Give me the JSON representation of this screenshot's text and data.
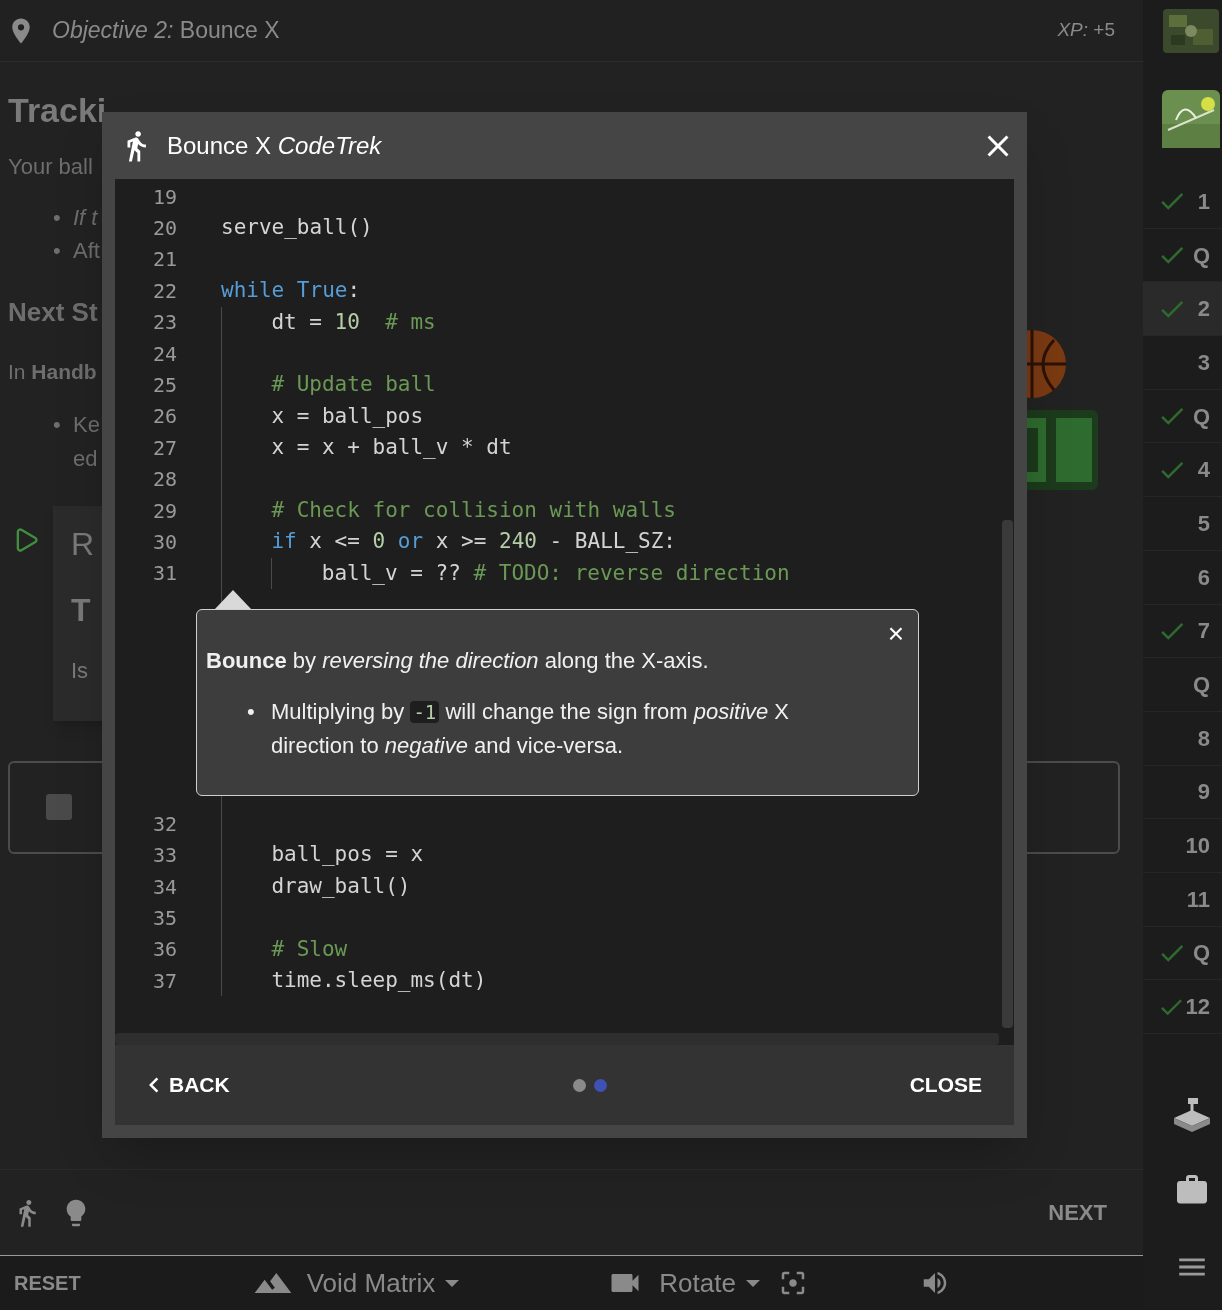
{
  "header": {
    "objective": "*Objective 2:* Bounce X",
    "xp": "*XP:* +5"
  },
  "lesson": {
    "title": "Tracki",
    "intro": "Your ball",
    "bullets": [
      {
        "marker": "•",
        "text": "If t",
        "italic": true
      },
      {
        "marker": "•",
        "text": "Aft",
        "italic": false
      }
    ],
    "next_heading": "Next St",
    "next_text": "In **Handb**",
    "next_bullet": {
      "marker": "•",
      "lines": [
        "Ke",
        "ed"
      ]
    },
    "run_card": {
      "title": "R",
      "subtitle": "T",
      "text": "Is"
    },
    "task": {
      "checked": false
    }
  },
  "dialog": {
    "title": "Bounce X *CodeTrek*",
    "code": [
      {
        "number": "19"
      },
      {
        "number": "20",
        "tokens": [
          {
            "text": "serve_ball()",
            "kind": "plain"
          }
        ]
      },
      {
        "number": "21"
      },
      {
        "number": "22",
        "tokens": [
          {
            "text": "while True",
            "kind": "keyword"
          },
          {
            "text": ":",
            "kind": "plain"
          }
        ]
      },
      {
        "number": "23",
        "tokens": [
          {
            "text": "    dt = ",
            "kind": "plain"
          },
          {
            "text": "10",
            "kind": "number"
          },
          {
            "text": "  # ms",
            "kind": "comment"
          }
        ]
      },
      {
        "number": "24"
      },
      {
        "number": "25",
        "tokens": [
          {
            "text": "    # Update ball",
            "kind": "comment"
          }
        ]
      },
      {
        "number": "26",
        "tokens": [
          {
            "text": "    x = ball_pos",
            "kind": "plain"
          }
        ]
      },
      {
        "number": "27",
        "tokens": [
          {
            "text": "    x = x + ball_v * dt",
            "kind": "plain"
          }
        ]
      },
      {
        "number": "28"
      },
      {
        "number": "29",
        "tokens": [
          {
            "text": "    # Check for collision with walls",
            "kind": "comment"
          }
        ]
      },
      {
        "number": "30",
        "tokens": [
          {
            "text": "    if",
            "kind": "keyword"
          },
          {
            "text": " x <= ",
            "kind": "plain"
          },
          {
            "text": "0",
            "kind": "number"
          },
          {
            "text": " or",
            "kind": "keyword"
          },
          {
            "text": " x >= ",
            "kind": "plain"
          },
          {
            "text": "240",
            "kind": "number"
          },
          {
            "text": " - BALL_SZ:",
            "kind": "plain"
          }
        ]
      },
      {
        "number": "31",
        "tokens": [
          {
            "text": "        ball_v = ?? ",
            "kind": "plain"
          },
          {
            "text": "# TODO: reverse direction",
            "kind": "comment"
          }
        ]
      },
      {
        "kind": "hint",
        "close": "×",
        "lead": "**Bounce** by *reversing the direction* along the X-axis.",
        "marker": "•",
        "bullet_before": "Multiplying by",
        "bullet_code": "-1",
        "bullet_after": "will change the sign from *positive* X direction to *negative* and vice-versa."
      },
      {
        "number": "32"
      },
      {
        "number": "33",
        "tokens": [
          {
            "text": "    ball_pos = x",
            "kind": "plain"
          }
        ]
      },
      {
        "number": "34",
        "tokens": [
          {
            "text": "    draw_ball()",
            "kind": "plain"
          }
        ]
      },
      {
        "number": "35"
      },
      {
        "number": "36",
        "tokens": [
          {
            "text": "    # Slow",
            "kind": "comment"
          }
        ]
      },
      {
        "number": "37",
        "tokens": [
          {
            "text": "    time.sleep_ms(dt)",
            "kind": "plain"
          }
        ]
      }
    ],
    "back": "BACK",
    "close": "CLOSE",
    "pages": [
      {
        "selected": false
      },
      {
        "selected": true
      }
    ]
  },
  "toolbar": {
    "next": "NEXT"
  },
  "bottom_bar": {
    "reset": "RESET",
    "environment": "Void Matrix",
    "camera": "Rotate"
  },
  "sidebar": {
    "items": [
      {
        "label": "1",
        "done": true,
        "selected": false
      },
      {
        "label": "Q",
        "done": true,
        "selected": false
      },
      {
        "label": "2",
        "done": true,
        "selected": true
      },
      {
        "label": "3",
        "done": false,
        "selected": false
      },
      {
        "label": "Q",
        "done": true,
        "selected": false
      },
      {
        "label": "4",
        "done": true,
        "selected": false
      },
      {
        "label": "5",
        "done": false,
        "selected": false
      },
      {
        "label": "6",
        "done": false,
        "selected": false
      },
      {
        "label": "7",
        "done": true,
        "selected": false
      },
      {
        "label": "Q",
        "done": false,
        "selected": false
      },
      {
        "label": "8",
        "done": false,
        "selected": false
      },
      {
        "label": "9",
        "done": false,
        "selected": false
      },
      {
        "label": "10",
        "done": false,
        "selected": false
      },
      {
        "label": "11",
        "done": false,
        "selected": false
      },
      {
        "label": "Q",
        "done": true,
        "selected": false
      },
      {
        "label": "12",
        "done": true,
        "selected": false
      }
    ]
  }
}
